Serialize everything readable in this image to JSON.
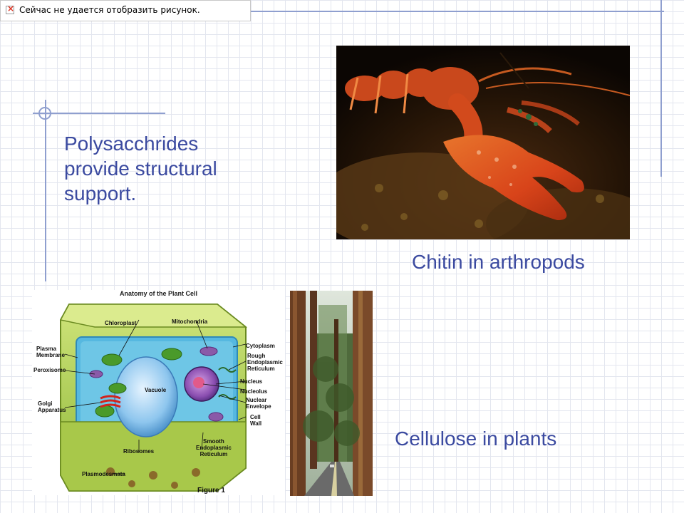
{
  "broken_image": {
    "text": "Сейчас не удается отобразить рисунок."
  },
  "slide": {
    "title": "Polysacchrides provide structural support.",
    "caption_chitin": "Chitin in arthropods",
    "caption_cellulose": "Cellulose in plants"
  },
  "plant_cell": {
    "title": "Anatomy of the Plant Cell",
    "figure_label": "Figure 1",
    "labels": {
      "chloroplast": "Chloroplast",
      "mitochondria": "Mitochondria",
      "plasma_membrane": "Plasma\nMembrane",
      "cytoplasm": "Cytoplasm",
      "rough_er": "Rough\nEndoplasmic\nReticulum",
      "peroxisome": "Peroxisome",
      "vacuole": "Vacuole",
      "nucleus": "Nucleus",
      "nucleolus": "Nucleolus",
      "golgi": "Golgi\nApparatus",
      "nuclear_envelope": "Nuclear\nEnvelope",
      "cell_wall": "Cell\nWall",
      "ribosomes": "Ribosomes",
      "smooth_er": "Smooth\nEndoplasmic\nReticulum",
      "plasmodesmata": "Plasmodesmata"
    }
  },
  "colors": {
    "text_blue": "#3b4aa0",
    "deco_line": "#8f9fcf",
    "grid": "#e3e6ef"
  }
}
